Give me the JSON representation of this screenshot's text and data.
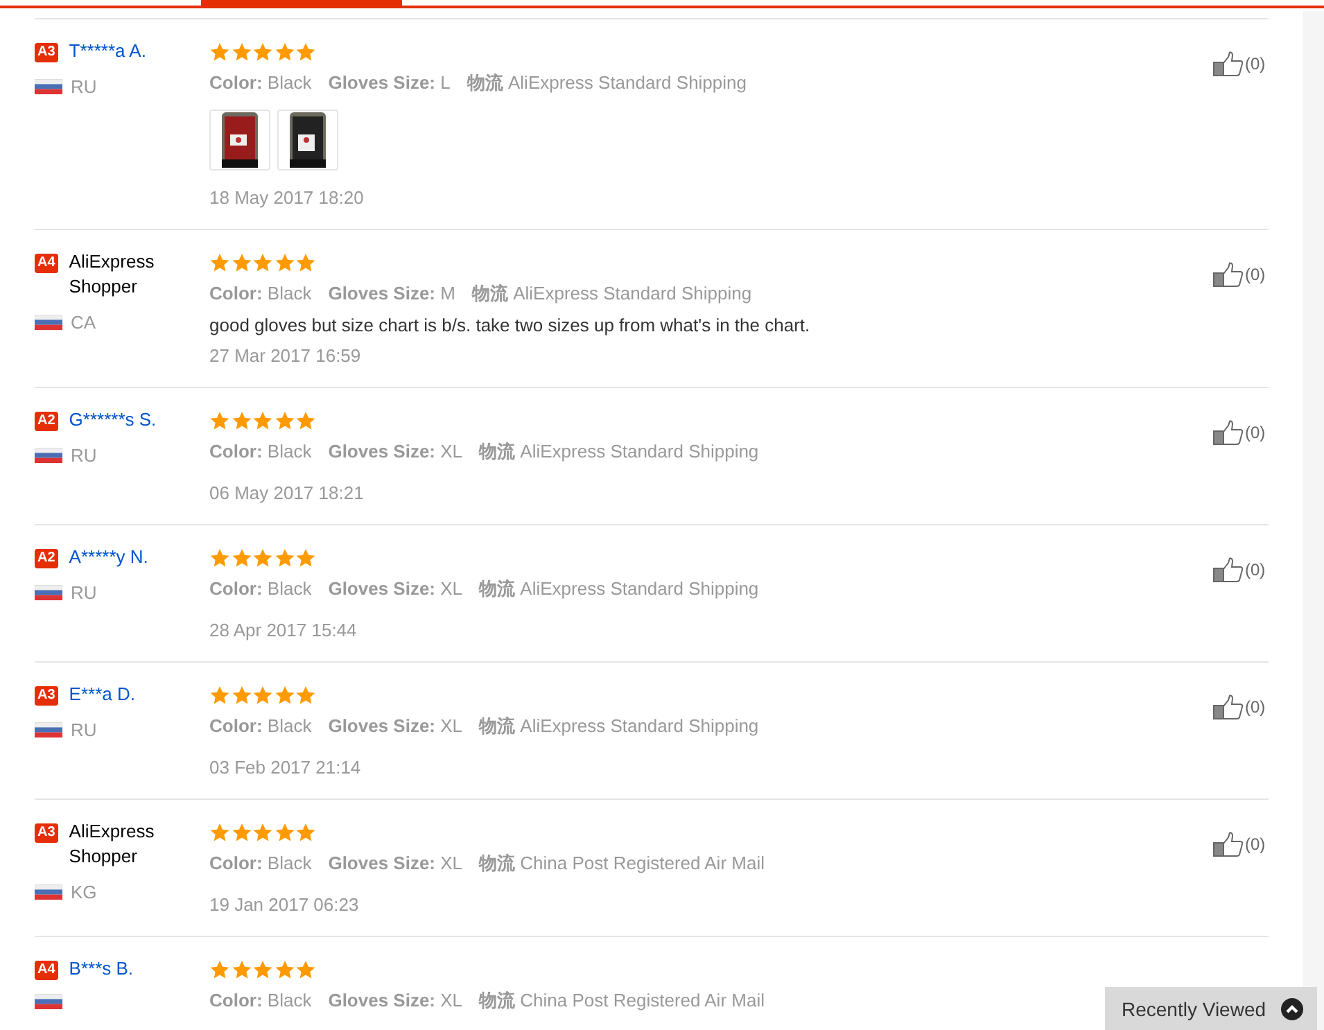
{
  "reviews": [
    {
      "badge": "A3",
      "name": "T*****a A.",
      "anonymous": false,
      "country": "RU",
      "stars": 5,
      "attributes": [
        {
          "label": "Color:",
          "value": "Black"
        },
        {
          "label": "Gloves Size:",
          "value": "L"
        },
        {
          "label": "物流",
          "value": "AliExpress Standard Shipping"
        }
      ],
      "photos": [
        {
          "kind": "picture"
        },
        {
          "kind": "picture"
        }
      ],
      "date": "18 May 2017 18:20",
      "likes": "(0)"
    },
    {
      "badge": "A4",
      "name": "AliExpress Shopper",
      "anonymous": true,
      "country": "CA",
      "stars": 5,
      "attributes": [
        {
          "label": "Color:",
          "value": "Black"
        },
        {
          "label": "Gloves Size:",
          "value": "M"
        },
        {
          "label": "物流",
          "value": "AliExpress Standard Shipping"
        }
      ],
      "comment": "good gloves but size chart is b/s. take two sizes up from what's in the chart.",
      "date": "27 Mar 2017 16:59",
      "likes": "(0)"
    },
    {
      "badge": "A2",
      "name": "G******s S.",
      "anonymous": false,
      "country": "RU",
      "stars": 5,
      "attributes": [
        {
          "label": "Color:",
          "value": "Black"
        },
        {
          "label": "Gloves Size:",
          "value": "XL"
        },
        {
          "label": "物流",
          "value": "AliExpress Standard Shipping"
        }
      ],
      "date": "06 May 2017 18:21",
      "likes": "(0)"
    },
    {
      "badge": "A2",
      "name": "A*****y N.",
      "anonymous": false,
      "country": "RU",
      "stars": 5,
      "attributes": [
        {
          "label": "Color:",
          "value": "Black"
        },
        {
          "label": "Gloves Size:",
          "value": "XL"
        },
        {
          "label": "物流",
          "value": "AliExpress Standard Shipping"
        }
      ],
      "date": "28 Apr 2017 15:44",
      "likes": "(0)"
    },
    {
      "badge": "A3",
      "name": "E***a D.",
      "anonymous": false,
      "country": "RU",
      "stars": 5,
      "attributes": [
        {
          "label": "Color:",
          "value": "Black"
        },
        {
          "label": "Gloves Size:",
          "value": "XL"
        },
        {
          "label": "物流",
          "value": "AliExpress Standard Shipping"
        }
      ],
      "date": "03 Feb 2017 21:14",
      "likes": "(0)"
    },
    {
      "badge": "A3",
      "name": "AliExpress Shopper",
      "anonymous": true,
      "country": "KG",
      "stars": 5,
      "attributes": [
        {
          "label": "Color:",
          "value": "Black"
        },
        {
          "label": "Gloves Size:",
          "value": "XL"
        },
        {
          "label": "物流",
          "value": "China Post Registered Air Mail"
        }
      ],
      "date": "19 Jan 2017 06:23",
      "likes": "(0)"
    },
    {
      "badge": "A4",
      "name": "B***s B.",
      "anonymous": false,
      "stars": 5,
      "attributes": [
        {
          "label": "Color:",
          "value": "Black"
        },
        {
          "label": "Gloves Size:",
          "value": "XL"
        },
        {
          "label": "物流",
          "value": "China Post Registered Air Mail"
        }
      ]
    }
  ],
  "recently_viewed": {
    "label": "Recently Viewed"
  }
}
